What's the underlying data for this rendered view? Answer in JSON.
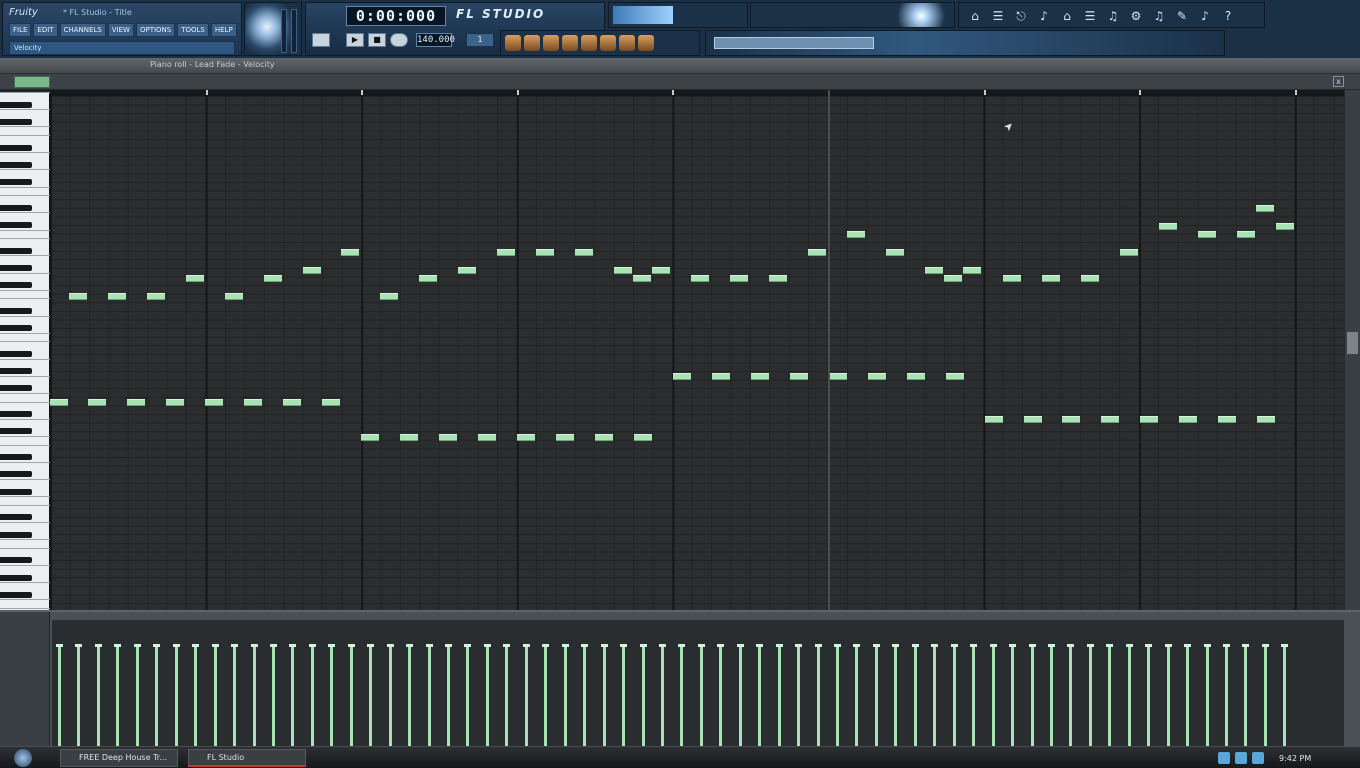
{
  "app": {
    "logo_text": "Fruity",
    "song_title": "* FL Studio - Title",
    "brand_text": "FL STUDIO"
  },
  "menu": {
    "items": [
      "FILE",
      "EDIT",
      "CHANNELS",
      "VIEW",
      "OPTIONS",
      "TOOLS",
      "HELP"
    ],
    "hint": "Velocity"
  },
  "transport": {
    "time_display": "0:00:000",
    "tempo": "140.000",
    "pattern": "1",
    "play_symbol": "▶",
    "stop_symbol": "■"
  },
  "piano_roll": {
    "title": "Piano roll - Lead Fade - Velocity",
    "close_symbol": "x"
  },
  "shortcuts": [
    "⌂",
    "☰",
    "⎋",
    "♪",
    "⌂",
    "☰",
    "♫",
    "⚙",
    "♫",
    "✎",
    "♪",
    "?"
  ],
  "taskbar": {
    "buttons": [
      "FREE Deep House Tr...",
      "FL Studio"
    ],
    "clock": "9:42 PM"
  },
  "colors": {
    "note": "#a9e2b5",
    "grid": "#2b2d2f",
    "toolbar": "#1b2f45"
  }
}
